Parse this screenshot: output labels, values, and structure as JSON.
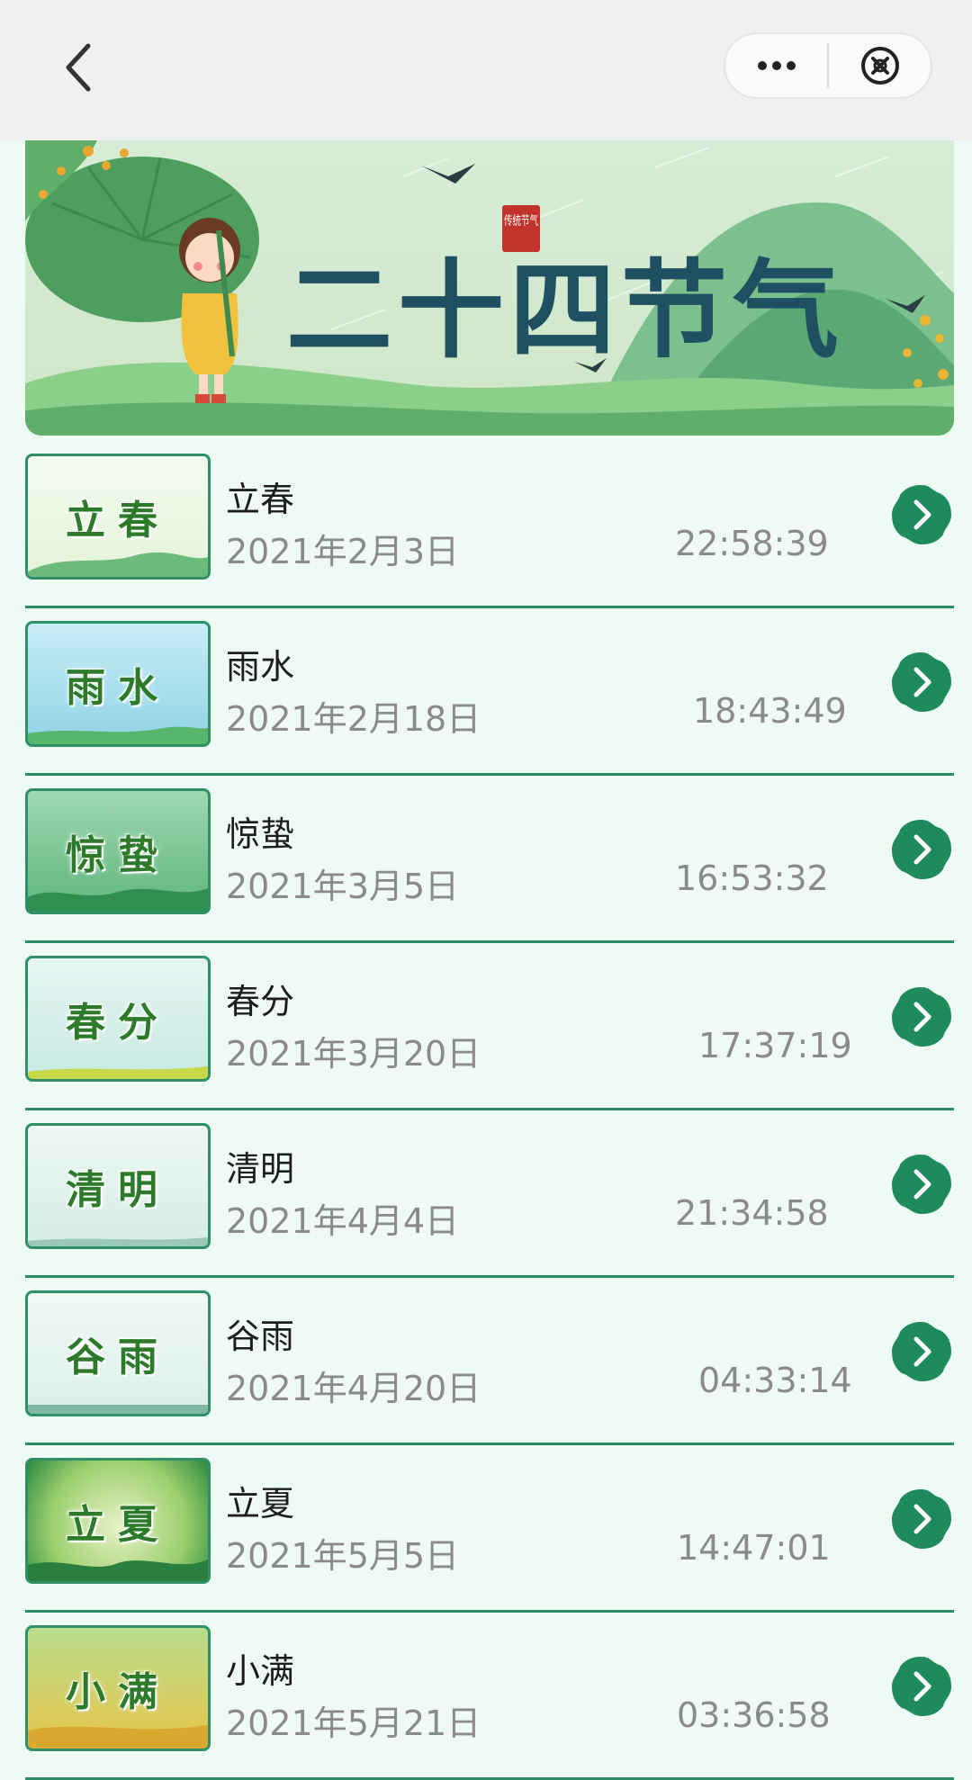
{
  "nav": {
    "back_icon": "chevron-left-icon",
    "more_icon": "more-dots-icon",
    "close_icon": "close-circle-icon"
  },
  "banner": {
    "title": "二十四节气",
    "seal": "传统节气"
  },
  "terms": [
    {
      "name": "立春",
      "date": "2021年2月3日",
      "time": "22:58:39"
    },
    {
      "name": "雨水",
      "date": "2021年2月18日",
      "time": "18:43:49"
    },
    {
      "name": "惊蛰",
      "date": "2021年3月5日",
      "time": "16:53:32"
    },
    {
      "name": "春分",
      "date": "2021年3月20日",
      "time": "17:37:19"
    },
    {
      "name": "清明",
      "date": "2021年4月4日",
      "time": "21:34:58"
    },
    {
      "name": "谷雨",
      "date": "2021年4月20日",
      "time": "04:33:14"
    },
    {
      "name": "立夏",
      "date": "2021年5月5日",
      "time": "14:47:01"
    },
    {
      "name": "小满",
      "date": "2021年5月21日",
      "time": "03:36:58"
    }
  ],
  "colors": {
    "accent": "#1f8a5a",
    "divider": "#2d8a66",
    "background": "#eefbf4"
  }
}
